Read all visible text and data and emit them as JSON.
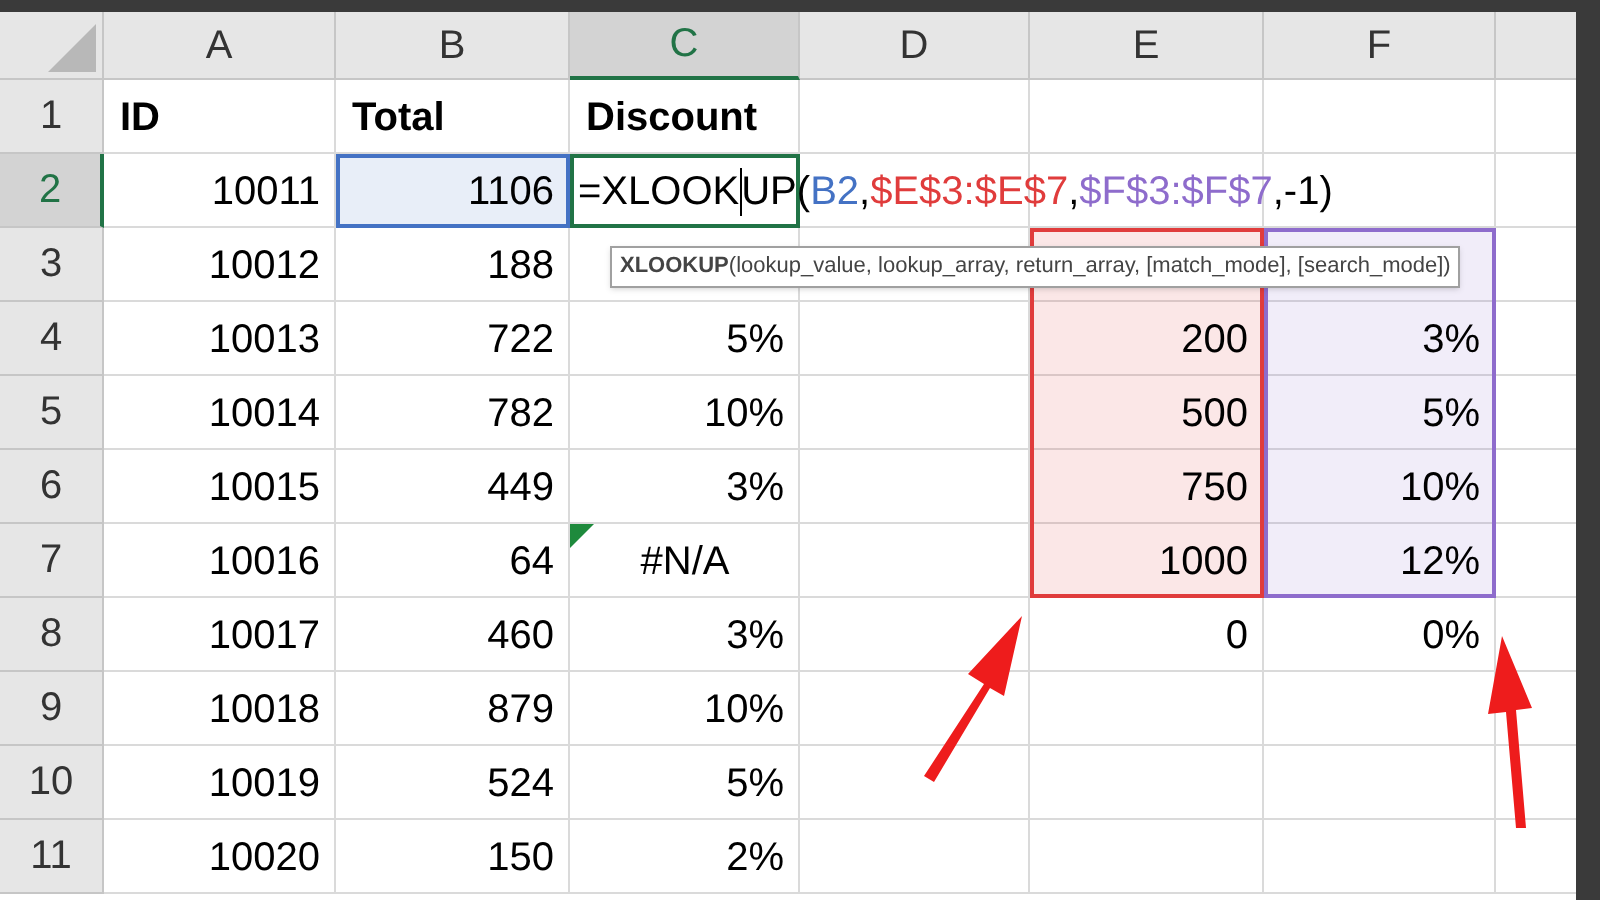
{
  "columns": [
    {
      "label": "A",
      "selected": false
    },
    {
      "label": "B",
      "selected": false
    },
    {
      "label": "C",
      "selected": true
    },
    {
      "label": "D",
      "selected": false
    },
    {
      "label": "E",
      "selected": false
    },
    {
      "label": "F",
      "selected": false
    }
  ],
  "rows": [
    {
      "number": "1",
      "selected": false,
      "cells": [
        {
          "text": "ID",
          "kind": "heading"
        },
        {
          "text": "Total",
          "kind": "heading"
        },
        {
          "text": "Discount",
          "kind": "heading"
        },
        null,
        null,
        null
      ]
    },
    {
      "number": "2",
      "selected": true,
      "cells": [
        {
          "text": "10011",
          "kind": "number"
        },
        {
          "text": "1106",
          "kind": "number",
          "color": "#4472c4"
        },
        {
          "kind": "formula",
          "active": true,
          "segments": [
            {
              "text": "=XLOOK",
              "caret": true
            },
            {
              "text": "UP("
            },
            {
              "text": "B2",
              "color": "#4472c4"
            },
            {
              "text": ","
            },
            {
              "text": "$E$3:$E$7",
              "color": "#e03c3c"
            },
            {
              "text": ","
            },
            {
              "text": "$F$3:$F$7",
              "color": "#8e6ccc"
            },
            {
              "text": ",-1)"
            }
          ]
        },
        null,
        null,
        null
      ]
    },
    {
      "number": "3",
      "selected": false,
      "cells": [
        {
          "text": "10012",
          "kind": "number"
        },
        {
          "text": "188",
          "kind": "number"
        },
        null,
        null,
        {
          "kind": "number",
          "color": "#e03c3c"
        },
        {
          "kind": "number",
          "color": "#8e6ccc"
        }
      ]
    },
    {
      "number": "4",
      "selected": false,
      "cells": [
        {
          "text": "10013",
          "kind": "number"
        },
        {
          "text": "722",
          "kind": "number"
        },
        {
          "text": "5%",
          "kind": "number"
        },
        null,
        {
          "text": "200",
          "kind": "number",
          "color": "#e03c3c"
        },
        {
          "text": "3%",
          "kind": "number",
          "color": "#8e6ccc"
        }
      ]
    },
    {
      "number": "5",
      "selected": false,
      "cells": [
        {
          "text": "10014",
          "kind": "number"
        },
        {
          "text": "782",
          "kind": "number"
        },
        {
          "text": "10%",
          "kind": "number"
        },
        null,
        {
          "text": "500",
          "kind": "number",
          "color": "#e03c3c"
        },
        {
          "text": "5%",
          "kind": "number",
          "color": "#8e6ccc"
        }
      ]
    },
    {
      "number": "6",
      "selected": false,
      "cells": [
        {
          "text": "10015",
          "kind": "number"
        },
        {
          "text": "449",
          "kind": "number"
        },
        {
          "text": "3%",
          "kind": "number"
        },
        null,
        {
          "text": "750",
          "kind": "number",
          "color": "#e03c3c"
        },
        {
          "text": "10%",
          "kind": "number",
          "color": "#8e6ccc"
        }
      ]
    },
    {
      "number": "7",
      "selected": false,
      "cells": [
        {
          "text": "10016",
          "kind": "number"
        },
        {
          "text": "64",
          "kind": "number"
        },
        {
          "text": "#N/A",
          "kind": "error",
          "error_flag": true
        },
        null,
        {
          "text": "1000",
          "kind": "number",
          "color": "#e03c3c"
        },
        {
          "text": "12%",
          "kind": "number",
          "color": "#8e6ccc"
        }
      ]
    },
    {
      "number": "8",
      "selected": false,
      "cells": [
        {
          "text": "10017",
          "kind": "number"
        },
        {
          "text": "460",
          "kind": "number"
        },
        {
          "text": "3%",
          "kind": "number"
        },
        null,
        {
          "text": "0",
          "kind": "number"
        },
        {
          "text": "0%",
          "kind": "number"
        }
      ]
    },
    {
      "number": "9",
      "selected": false,
      "cells": [
        {
          "text": "10018",
          "kind": "number"
        },
        {
          "text": "879",
          "kind": "number"
        },
        {
          "text": "10%",
          "kind": "number"
        },
        null,
        null,
        null
      ]
    },
    {
      "number": "10",
      "selected": false,
      "cells": [
        {
          "text": "10019",
          "kind": "number"
        },
        {
          "text": "524",
          "kind": "number"
        },
        {
          "text": "5%",
          "kind": "number"
        },
        null,
        null,
        null
      ]
    },
    {
      "number": "11",
      "selected": false,
      "cells": [
        {
          "text": "10020",
          "kind": "number"
        },
        {
          "text": "150",
          "kind": "number"
        },
        {
          "text": "2%",
          "kind": "number"
        },
        null,
        null,
        null
      ]
    }
  ],
  "tooltip": {
    "function": "XLOOKUP",
    "arguments": "(lookup_value, lookup_array, return_array, [match_mode], [search_mode])"
  }
}
